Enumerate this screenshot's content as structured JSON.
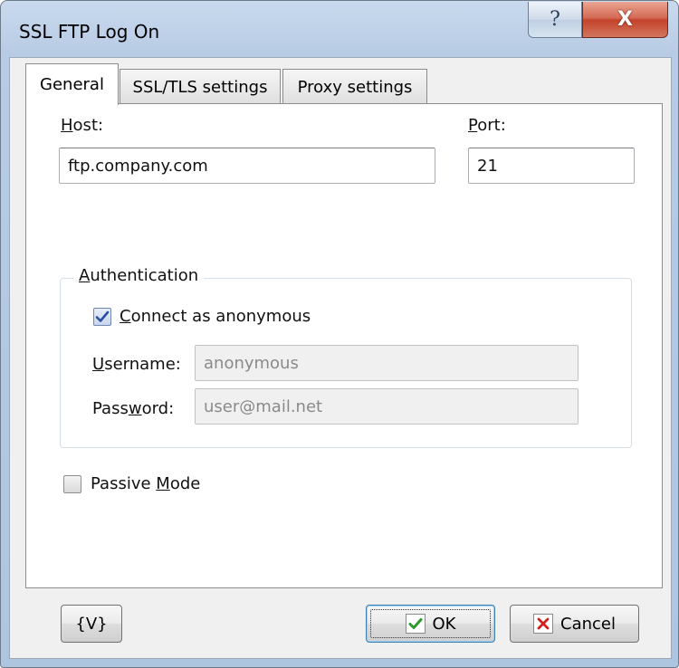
{
  "window": {
    "title": "SSL FTP Log On",
    "help_glyph": "?",
    "close_glyph": "X"
  },
  "tabs": [
    {
      "label": "General",
      "active": true
    },
    {
      "label": "SSL/TLS settings",
      "active": false
    },
    {
      "label": "Proxy settings",
      "active": false
    }
  ],
  "general": {
    "host_label_mnemonic": "H",
    "host_label_rest": "ost:",
    "host_value": "ftp.company.com",
    "port_label_mnemonic": "P",
    "port_label_rest": "ort:",
    "port_value": "21",
    "authentication": {
      "title_mnemonic": "A",
      "title_rest": "uthentication",
      "anonymous_mnemonic": "C",
      "anonymous_rest": "onnect as anonymous",
      "anonymous_checked": true,
      "username_mnemonic": "U",
      "username_rest": "sername:",
      "username_value": "anonymous",
      "password_pre": "Pass",
      "password_mnemonic": "w",
      "password_post": "ord:",
      "password_value": "user@mail.net"
    },
    "passive_pre": "Passive ",
    "passive_mnemonic": "M",
    "passive_post": "ode",
    "passive_checked": false
  },
  "buttons": {
    "variables_label": "{V}",
    "ok_label": "OK",
    "cancel_label": "Cancel"
  },
  "colors": {
    "ok_check": "#2e9a2e",
    "cancel_x": "#d02020",
    "check_mark": "#2c4f9e"
  }
}
